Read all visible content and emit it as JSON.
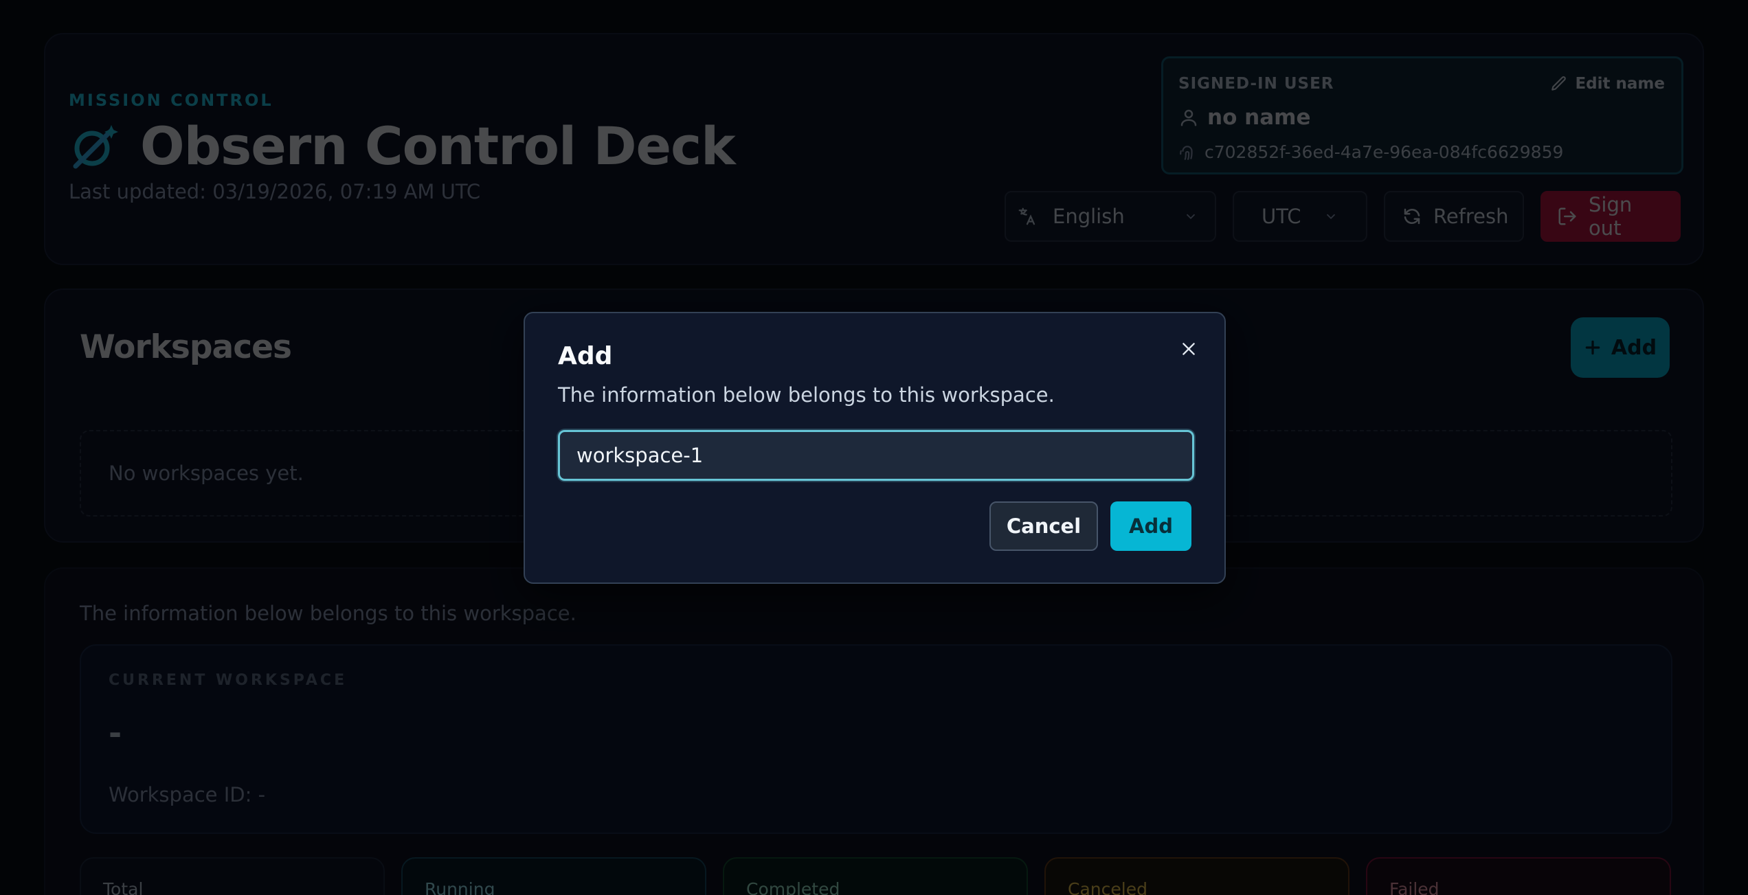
{
  "header": {
    "eyebrow": "MISSION CONTROL",
    "title": "Obsern Control Deck",
    "last_updated": "Last updated: 03/19/2026, 07:19 AM UTC",
    "logo_icon": "satellite-icon",
    "accent_color": "#22d3ee"
  },
  "user_card": {
    "label": "SIGNED-IN USER",
    "edit_label": "Edit name",
    "name": "no name",
    "user_id": "c702852f-36ed-4a7e-96ea-084fc6629859"
  },
  "controls": {
    "language": "English",
    "timezone": "UTC",
    "refresh_label": "Refresh",
    "signout_label": "Sign out",
    "signout_color": "#be123c"
  },
  "workspaces": {
    "title": "Workspaces",
    "add_label": "Add",
    "empty_text": "No workspaces yet."
  },
  "info": {
    "note": "The information below belongs to this workspace.",
    "current_label": "CURRENT WORKSPACE",
    "current_name": "-",
    "workspace_id": "Workspace ID: -"
  },
  "stats": [
    {
      "label": "Total"
    },
    {
      "label": "Running"
    },
    {
      "label": "Completed"
    },
    {
      "label": "Canceled"
    },
    {
      "label": "Failed"
    }
  ],
  "modal": {
    "title": "Add",
    "description": "The information below belongs to this workspace.",
    "input_value": "workspace-1",
    "cancel_label": "Cancel",
    "confirm_label": "Add",
    "confirm_color": "#06b6d4"
  }
}
